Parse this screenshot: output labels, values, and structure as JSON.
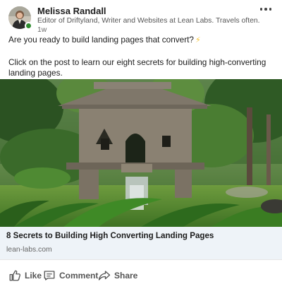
{
  "post": {
    "author": {
      "name": "Melissa Randall",
      "headline": "Editor of Driftyland, Writer and Websites at Lean Labs. Travels often.",
      "time": "1w",
      "presence_color": "#2e8b2e"
    },
    "more_icon": "more-horizontal-icon",
    "text": {
      "line1": "Are you ready to build landing pages that convert?",
      "line1_emoji": "⚡",
      "line2": "Click on the post to learn our eight secrets for building high-converting landing pages."
    },
    "image": {
      "icon": "garden-stupa-photo"
    },
    "link_preview": {
      "title": "8 Secrets to Building High Converting Landing Pages",
      "domain": "lean-labs.com",
      "background": "#eef3f8"
    },
    "actions": {
      "like_label": "Like",
      "comment_label": "Comment",
      "share_label": "Share",
      "like_icon": "thumbs-up-icon",
      "comment_icon": "comment-icon",
      "share_icon": "share-arrow-icon"
    }
  }
}
